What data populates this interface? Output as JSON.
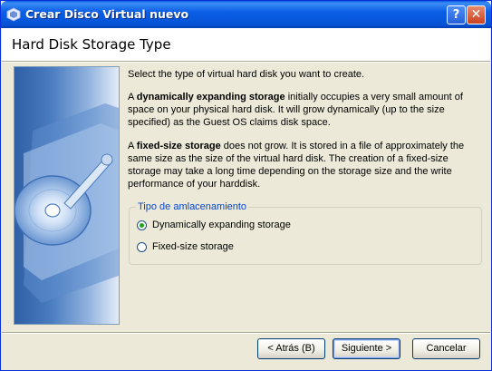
{
  "window": {
    "title": "Crear Disco Virtual nuevo",
    "help_button": "?",
    "close_button": "✕"
  },
  "header": {
    "title": "Hard Disk Storage Type"
  },
  "intro": "Select the type of virtual hard disk you want to create.",
  "dynamic": {
    "bold": "dynamically expanding storage",
    "prefix": "A ",
    "text": " initially occupies a very small amount of space on your physical hard disk. It will grow dynamically (up to the size specified) as the Guest OS claims disk space."
  },
  "fixed": {
    "prefix": "A ",
    "bold": "fixed-size storage",
    "text": " does not grow. It is stored in a file of approximately the same size as the size of the virtual hard disk. The creation of a fixed-size storage may take a long time depending on the storage size and the write performance of your harddisk."
  },
  "storage_group": {
    "label": "Tipo de amlacenamiento",
    "options": [
      {
        "label": "Dynamically expanding storage",
        "selected": true
      },
      {
        "label": "Fixed-size storage",
        "selected": false
      }
    ]
  },
  "buttons": {
    "back": "< Atrás (B)",
    "next": "Siguiente >",
    "cancel": "Cancelar"
  }
}
